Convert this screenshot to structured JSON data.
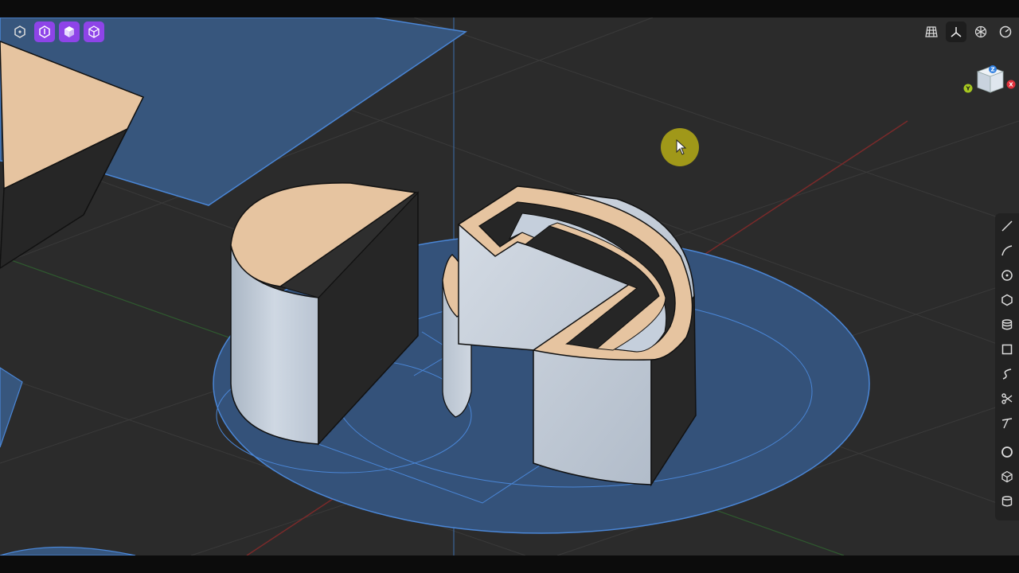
{
  "toolbar": {
    "mode_buttons": [
      {
        "name": "select-mode-button",
        "icon": "hexagon-outline-icon",
        "active": false
      },
      {
        "name": "solid-mode-button",
        "icon": "pen-hexagon-icon",
        "active": true
      },
      {
        "name": "body-mode-button",
        "icon": "solid-cube-icon",
        "active": true
      },
      {
        "name": "wireframe-mode-button",
        "icon": "wire-cube-icon",
        "active": true
      }
    ],
    "view_buttons": [
      {
        "name": "grid-toggle-button",
        "icon": "grid-icon"
      },
      {
        "name": "axes-toggle-button",
        "icon": "axes-icon"
      },
      {
        "name": "snap-toggle-button",
        "icon": "snowflake-icon"
      },
      {
        "name": "measure-toggle-button",
        "icon": "gauge-icon"
      }
    ]
  },
  "side_tools": [
    {
      "name": "line-tool",
      "icon": "line-icon"
    },
    {
      "name": "arc-tool",
      "icon": "arc-icon"
    },
    {
      "name": "circle-tool",
      "icon": "circle-center-icon"
    },
    {
      "name": "polygon-tool",
      "icon": "hexagon-icon"
    },
    {
      "name": "extrude-tool",
      "icon": "stack-icon"
    },
    {
      "name": "rectangle-tool",
      "icon": "square-icon"
    },
    {
      "name": "spline-tool",
      "icon": "spline-icon"
    },
    {
      "name": "trim-tool",
      "icon": "scissors-icon"
    },
    {
      "name": "offset-tool",
      "icon": "offset-icon"
    },
    {
      "name": "shell-tool",
      "icon": "ring-icon"
    },
    {
      "name": "box-tool",
      "icon": "cube-icon"
    },
    {
      "name": "cylinder-tool",
      "icon": "cylinder-icon"
    }
  ],
  "nav_cube": {
    "z_label": "Z",
    "y_label": "Y",
    "x_label": "X"
  },
  "colors": {
    "background": "#2b2b2b",
    "sketch_fill": "#3a5f8f",
    "sketch_edge": "#4a86d6",
    "top_face": "#e6c4a0",
    "side_light": "#c2cedd",
    "side_dark": "#262626",
    "accent": "#8e44e8",
    "cursor": "#c8be14"
  }
}
